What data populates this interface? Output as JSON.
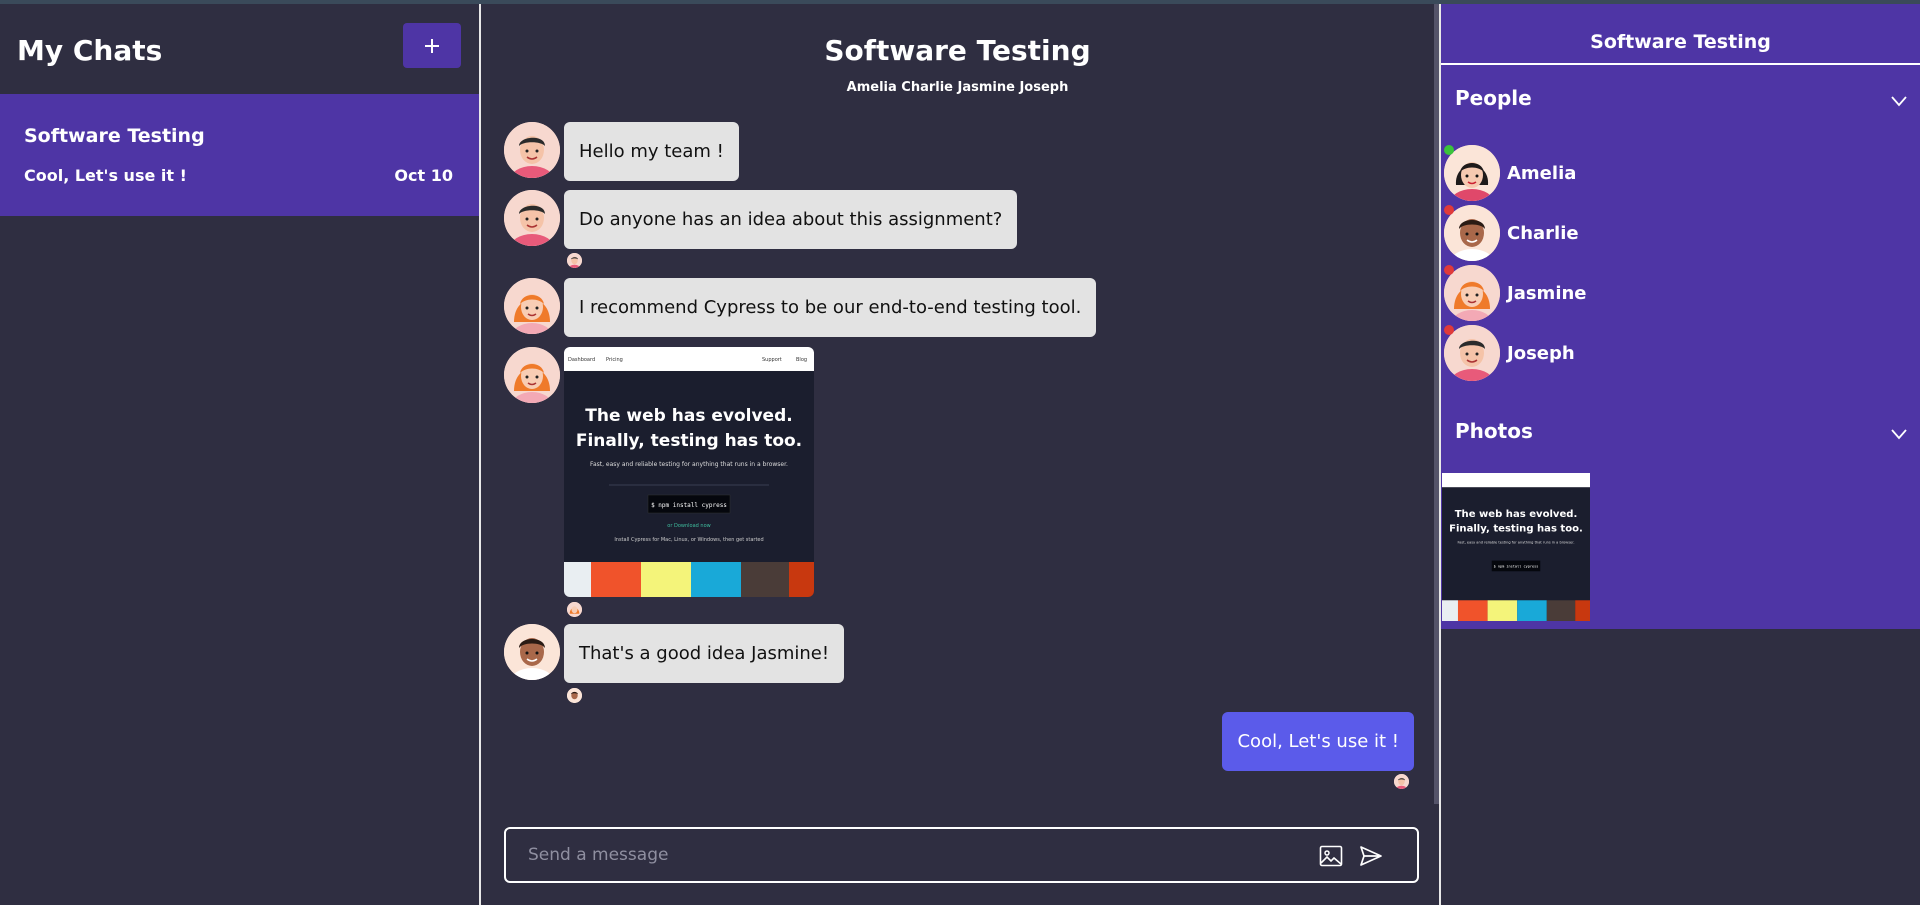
{
  "sidebar": {
    "title": "My Chats",
    "new_chat_icon": "plus-icon",
    "chats": [
      {
        "name": "Software Testing",
        "last_message": "Cool, Let's use it !",
        "date": "Oct 10"
      }
    ]
  },
  "chat": {
    "title": "Software Testing",
    "members": "Amelia Charlie Jasmine Joseph",
    "messages": [
      {
        "sender": "Joseph",
        "text": "Hello my team !"
      },
      {
        "sender": "Joseph",
        "text": "Do anyone has an idea about this assignment?"
      },
      {
        "sender": "Jasmine",
        "text": "I recommend Cypress to be our end-to-end testing tool."
      },
      {
        "sender": "Jasmine",
        "type": "image"
      },
      {
        "sender": "Charlie",
        "text": "That's a good idea Jasmine!"
      },
      {
        "sender": "me",
        "text": "Cool, Let's use it !"
      }
    ],
    "composer": {
      "placeholder": "Send a message",
      "image_icon": "image-icon",
      "send_icon": "send-icon"
    }
  },
  "shared_image": {
    "nav": [
      "Dashboard",
      "Pricing",
      "Support",
      "Blog"
    ],
    "headline_1": "The web has evolved.",
    "headline_2": "Finally, testing has too.",
    "subtitle": "Fast, easy and reliable testing for anything that runs in a browser.",
    "command": "$ npm install cypress",
    "download": "or Download now",
    "install_note": "Install Cypress for Mac, Linux, or Windows, then get started",
    "palette": [
      "#e9eef2",
      "#f0532b",
      "#f4f47a",
      "#19a9d8",
      "#4a3c38",
      "#c8380f"
    ]
  },
  "details": {
    "title": "Software Testing",
    "people_label": "People",
    "photos_label": "Photos",
    "people": [
      {
        "name": "Amelia",
        "status_color": "#3bc43b"
      },
      {
        "name": "Charlie",
        "status_color": "#e03a3a"
      },
      {
        "name": "Jasmine",
        "status_color": "#e03a3a"
      },
      {
        "name": "Joseph",
        "status_color": "#e03a3a"
      }
    ]
  },
  "colors": {
    "accent": "#4e35a5",
    "background": "#2f2e41",
    "own_bubble": "#5b5bea",
    "bubble": "#e3e3e3"
  }
}
